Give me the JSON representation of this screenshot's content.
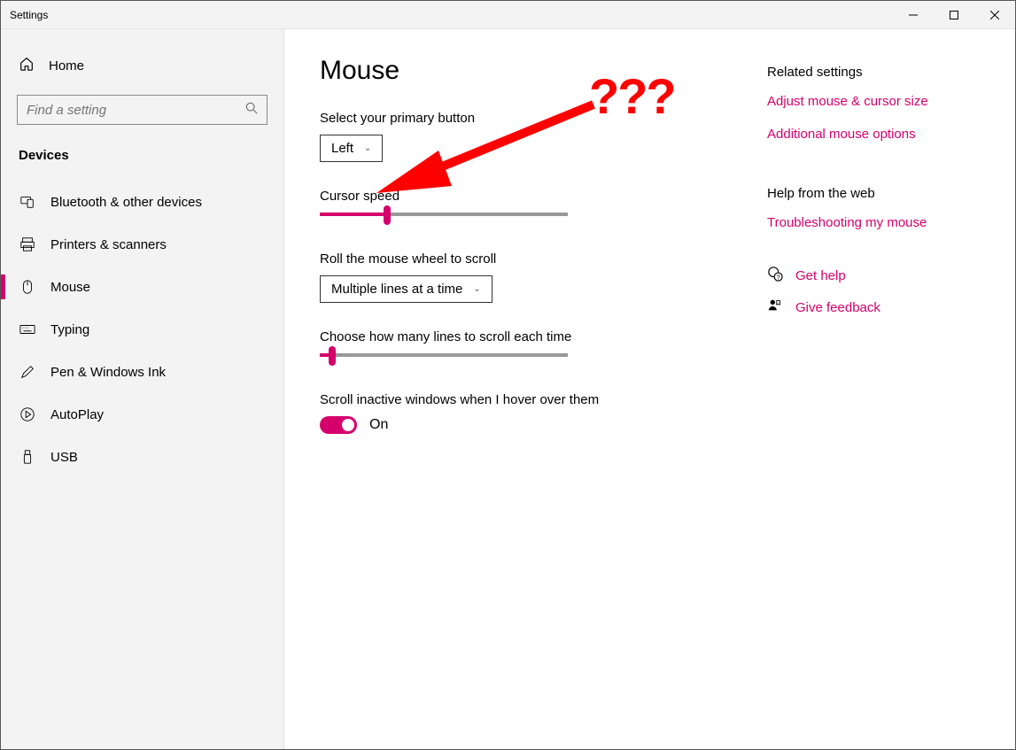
{
  "window": {
    "title": "Settings"
  },
  "sidebar": {
    "home": "Home",
    "search_placeholder": "Find a setting",
    "section": "Devices",
    "items": [
      {
        "label": "Bluetooth & other devices"
      },
      {
        "label": "Printers & scanners"
      },
      {
        "label": "Mouse"
      },
      {
        "label": "Typing"
      },
      {
        "label": "Pen & Windows Ink"
      },
      {
        "label": "AutoPlay"
      },
      {
        "label": "USB"
      }
    ]
  },
  "page": {
    "heading": "Mouse",
    "primary_button_label": "Select your primary button",
    "primary_button_value": "Left",
    "cursor_speed_label": "Cursor speed",
    "cursor_speed_percent": 27,
    "scroll_label": "Roll the mouse wheel to scroll",
    "scroll_value": "Multiple lines at a time",
    "lines_label": "Choose how many lines to scroll each time",
    "lines_percent": 5,
    "hover_label": "Scroll inactive windows when I hover over them",
    "hover_value": "On"
  },
  "right": {
    "related_heading": "Related settings",
    "link1": "Adjust mouse & cursor size",
    "link2": "Additional mouse options",
    "help_heading": "Help from the web",
    "link3": "Troubleshooting my mouse",
    "get_help": "Get help",
    "feedback": "Give feedback"
  },
  "annotation": {
    "text": "???"
  },
  "colors": {
    "accent": "#d6006c",
    "annotation": "#ff0000"
  }
}
